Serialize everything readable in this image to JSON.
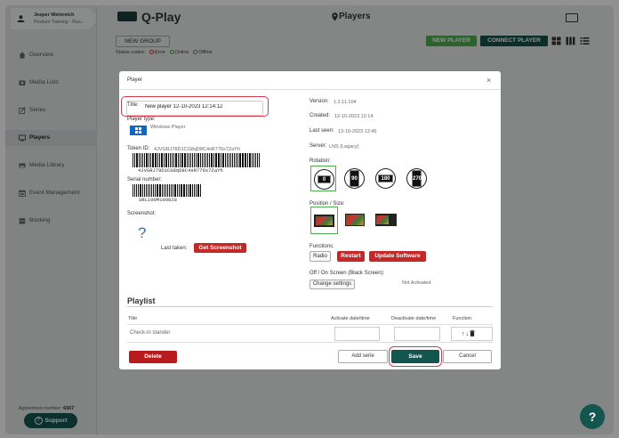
{
  "sidebar": {
    "user_name": "Jesper Weinreich",
    "user_sub": "Product Training - Rus...",
    "items": [
      {
        "label": "Overview",
        "icon": "home-icon"
      },
      {
        "label": "Media Lists",
        "icon": "media-lists-icon"
      },
      {
        "label": "Series",
        "icon": "series-icon"
      },
      {
        "label": "Players",
        "icon": "players-icon",
        "active": true
      },
      {
        "label": "Media Library",
        "icon": "media-library-icon"
      },
      {
        "label": "Event Management",
        "icon": "calendar-icon"
      },
      {
        "label": "Booking",
        "icon": "booking-icon"
      }
    ],
    "agreement_label": "Agreement number:",
    "agreement_number": "6567",
    "support_label": "Support"
  },
  "header": {
    "logo_text": "Q-Play",
    "page_title": "Players"
  },
  "toolbar": {
    "new_group": "NEW GROUP",
    "status_codes_label": "Status codes:",
    "status_error": "Error",
    "status_online": "Online",
    "status_offline": "Offline",
    "new_player": "NEW PLAYER",
    "connect_player": "CONNECT PLAYER"
  },
  "modal": {
    "title": "Player",
    "close": "×",
    "title_label": "Title:",
    "title_value": "New player 12-10-2023 12:14:12",
    "player_type_label": "Player type:",
    "player_type_value": "Windows Player",
    "token_label": "Token ID:",
    "token_value": "4JVGRJ78D1CG8qD8C4sR776s7ZaYh",
    "token_barcode_text": "4JVGRJ78D1CG8qD8C4sR776s7ZaYh",
    "serial_label": "Serial number:",
    "serial_value": "SRL100M100028",
    "screenshot_label": "Screenshot:",
    "screenshot_placeholder": "?",
    "last_taken_label": "Last taken:",
    "get_screenshot": "Get Screenshot",
    "version_label": "Version:",
    "version_value": "1.2.11.104",
    "created_label": "Created:",
    "created_value": "12-10-2023 12:14",
    "last_seen_label": "Last seen:",
    "last_seen_value": "13-10-2023 12:45",
    "server_label": "Server:",
    "server_value": "LNS (Legacy)",
    "rotation_label": "Rotation:",
    "rotations": [
      "0",
      "90",
      "180",
      "270"
    ],
    "selected_rotation": "0",
    "position_label": "Position / Size:",
    "functions_label": "Functions:",
    "fn_radio": "Radio",
    "fn_restart": "Restart",
    "fn_update": "Update Software",
    "offon_label": "Off / On Screen (Black Screen):",
    "change_settings": "Change settings",
    "not_activated": "Not Activated",
    "playlist_title": "Playlist",
    "col_title": "Title",
    "col_activate": "Activate date/time",
    "col_deactivate": "Deactivate date/time",
    "col_function": "Function",
    "row_title": "Check-in stander",
    "row_icons": "↑↓🗑",
    "delete": "Delete",
    "add_serie": "Add serie",
    "save": "Save",
    "cancel": "Cancel"
  },
  "help_button": "?",
  "colors": {
    "brand_dark": "#13564f",
    "accent_green": "#4caf50",
    "danger": "#c62828",
    "highlight": "#d63a4a"
  }
}
